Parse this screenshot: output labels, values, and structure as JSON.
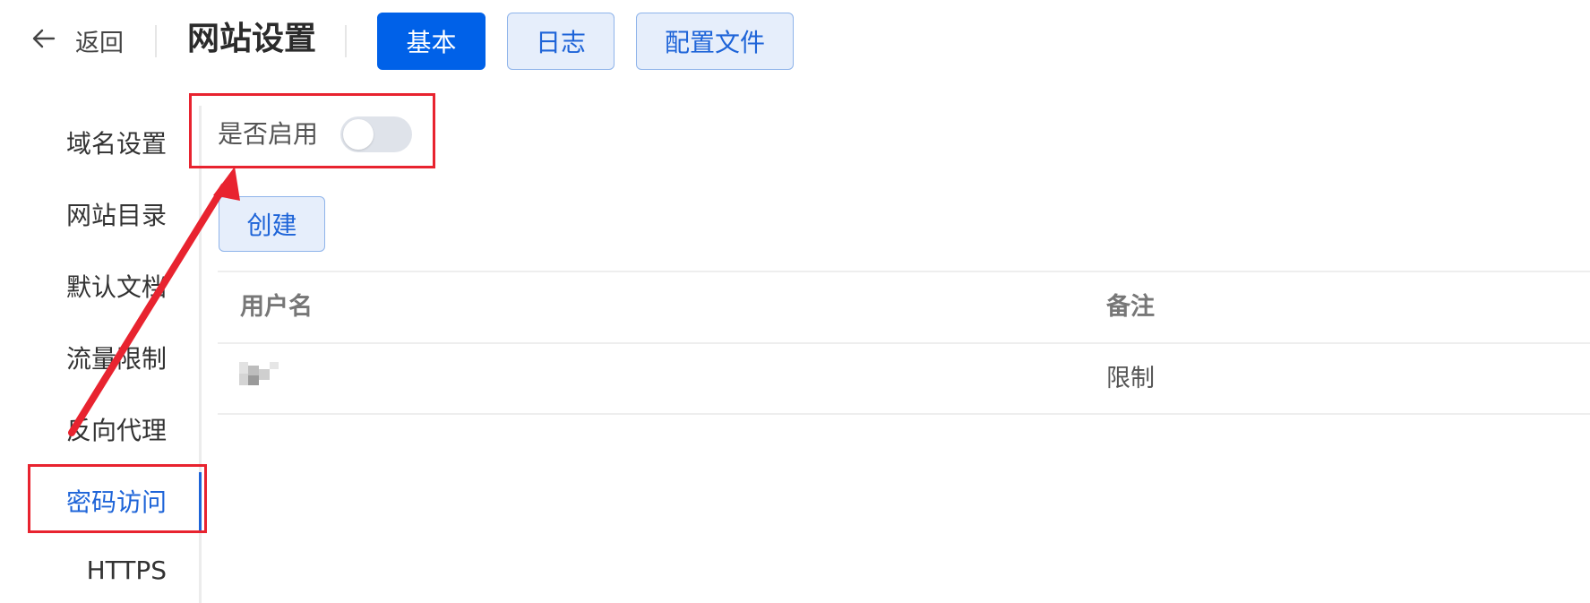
{
  "header": {
    "back_label": "返回",
    "title": "网站设置",
    "tabs": [
      {
        "label": "基本",
        "active": true
      },
      {
        "label": "日志",
        "active": false
      },
      {
        "label": "配置文件",
        "active": false
      }
    ]
  },
  "sidebar": {
    "items": [
      {
        "label": "域名设置"
      },
      {
        "label": "网站目录"
      },
      {
        "label": "默认文档"
      },
      {
        "label": "流量限制"
      },
      {
        "label": "反向代理"
      },
      {
        "label": "密码访问",
        "active": true
      },
      {
        "label": "HTTPS"
      }
    ]
  },
  "main": {
    "toggle": {
      "label": "是否启用",
      "enabled": false
    },
    "create_label": "创建",
    "table": {
      "columns": [
        "用户名",
        "备注"
      ],
      "rows": [
        {
          "username": "",
          "note": "限制"
        }
      ]
    }
  },
  "colors": {
    "primary": "#0061e8",
    "link": "#1e64d8",
    "annotation": "#e8232f"
  },
  "icons": {
    "back": "arrow-left-icon"
  }
}
